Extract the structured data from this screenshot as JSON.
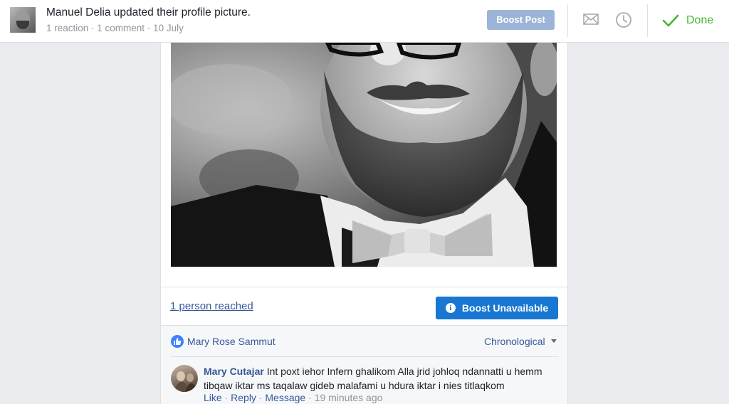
{
  "header": {
    "title": "Manuel Delia updated their profile picture.",
    "meta": "1 reaction · 1 comment · 10 July",
    "boost_post": "Boost Post",
    "done": "Done",
    "icons": [
      "envelope-icon",
      "clock-icon",
      "checkmark-icon"
    ]
  },
  "post": {
    "reach": "1 person reached",
    "boost_unavailable": "Boost Unavailable",
    "info_glyph": "i"
  },
  "reactions": {
    "liker": "Mary Rose Sammut",
    "order": "Chronological"
  },
  "comment": {
    "author": "Mary Cutajar",
    "text": "Int poxt iehor Infern ghalikom Alla jrid johloq ndannatti u hemm tibqaw iktar ms taqalaw gideb malafami u hdura iktar i nies titlaqkom",
    "like": "Like",
    "reply": "Reply",
    "message": "Message",
    "time": "19 minutes ago",
    "separator": " · "
  },
  "colors": {
    "link": "#365899",
    "boost_blue": "#1877d2",
    "boost_disabled": "#9cb4d8",
    "done_green": "#42b72a"
  }
}
